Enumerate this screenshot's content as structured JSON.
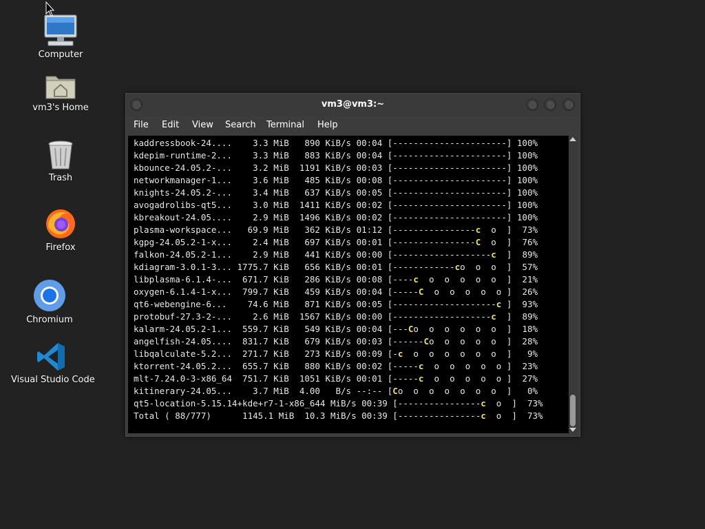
{
  "desktop": {
    "icons": [
      {
        "label": "Computer"
      },
      {
        "label": "vm3's Home"
      },
      {
        "label": "Trash"
      },
      {
        "label": "Firefox"
      },
      {
        "label": "Chromium"
      },
      {
        "label": "Visual Studio Code"
      }
    ]
  },
  "window": {
    "title": "vm3@vm3:~",
    "menu": [
      "File",
      "Edit",
      "View",
      "Search",
      "Terminal",
      "Help"
    ]
  },
  "terminal": {
    "lines": [
      "kaddressbook-24....    3.3 MiB   890 KiB/s 00:04 [----------------------] 100%",
      "kdepim-runtime-2...    3.3 MiB   883 KiB/s 00:04 [----------------------] 100%",
      "kbounce-24.05.2-...    3.2 MiB  1191 KiB/s 00:03 [----------------------] 100%",
      "networkmanager-1...    3.6 MiB   485 KiB/s 00:08 [----------------------] 100%",
      "knights-24.05.2-...    3.4 MiB   637 KiB/s 00:05 [----------------------] 100%",
      "avogadrolibs-qt5...    3.0 MiB  1411 KiB/s 00:02 [----------------------] 100%",
      "kbreakout-24.05....    2.9 MiB  1496 KiB/s 00:02 [----------------------] 100%",
      "plasma-workspace...   69.9 MiB   362 KiB/s 01:12 [----------------c  o  ]  73%",
      "kgpg-24.05.2-1-x...    2.4 MiB   697 KiB/s 00:01 [----------------C  o  ]  76%",
      "falkon-24.05.2-1...    2.9 MiB   441 KiB/s 00:00 [-------------------c  ]  89%",
      "kdiagram-3.0.1-3... 1775.7 KiB   656 KiB/s 00:01 [------------co  o  o  ]  57%",
      "libplasma-6.1.4-...  671.7 KiB   286 KiB/s 00:08 [----c  o  o  o  o  o  ]  21%",
      "oxygen-6.1.4-1-x...  799.7 KiB   459 KiB/s 00:04 [-----C  o  o  o  o  o ]  26%",
      "qt6-webengine-6...    74.6 MiB   871 KiB/s 00:05 [--------------------c ]  93%",
      "protobuf-27.3-2-...    2.6 MiB  1567 KiB/s 00:00 [-------------------c  ]  89%",
      "kalarm-24.05.2-1...  559.7 KiB   549 KiB/s 00:04 [---Co  o  o  o  o  o  ]  18%",
      "angelfish-24.05....  831.7 KiB   679 KiB/s 00:03 [------Co  o  o  o  o  ]  28%",
      "libqalculate-5.2...  271.7 KiB   273 KiB/s 00:09 [-c  o  o  o  o  o  o  ]   9%",
      "ktorrent-24.05.2...  655.7 KiB   880 KiB/s 00:02 [-----c  o  o  o  o  o ]  23%",
      "mlt-7.24.0-3-x86_64  751.7 KiB  1051 KiB/s 00:01 [-----c  o  o  o  o  o ]  27%",
      "kitinerary-24.05...    3.7 MiB  4.00   B/s --:-- [Co  o  o  o  o  o  o  ]   0%",
      "qt5-location-5.15.14+kde+r7-1-x86_644 MiB/s 00:39 [----------------c  o  ]  73%",
      "Total ( 88/777)      1145.1 MiB  10.3 MiB/s 00:39 [----------------c  o  ]  73%"
    ]
  },
  "colors": {
    "desktop_bg": "#222222",
    "terminal_bg": "#000000",
    "terminal_fg": "#e8e8e8",
    "pacman_highlight": "#f0e060"
  }
}
